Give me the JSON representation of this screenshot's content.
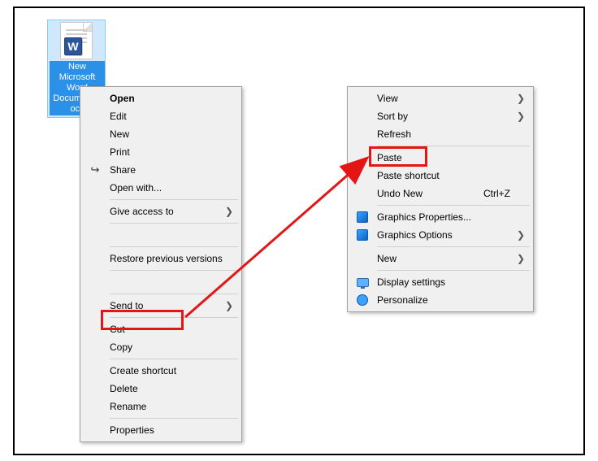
{
  "icon": {
    "badge": "W",
    "filename": "New Microsoft Word Document.docx"
  },
  "menu1": {
    "open": "Open",
    "edit": "Edit",
    "new": "New",
    "print": "Print",
    "share": "Share",
    "open_with": "Open with...",
    "give_access": "Give access to",
    "restore": "Restore previous versions",
    "send_to": "Send to",
    "cut": "Cut",
    "copy": "Copy",
    "create_shortcut": "Create shortcut",
    "delete": "Delete",
    "rename": "Rename",
    "properties": "Properties"
  },
  "menu2": {
    "view": "View",
    "sort_by": "Sort by",
    "refresh": "Refresh",
    "paste": "Paste",
    "paste_shortcut": "Paste shortcut",
    "undo_new": "Undo New",
    "undo_sc": "Ctrl+Z",
    "gprops": "Graphics Properties...",
    "gopts": "Graphics Options",
    "new": "New",
    "display": "Display settings",
    "personalize": "Personalize"
  },
  "glyphs": {
    "submenu": "❯"
  }
}
